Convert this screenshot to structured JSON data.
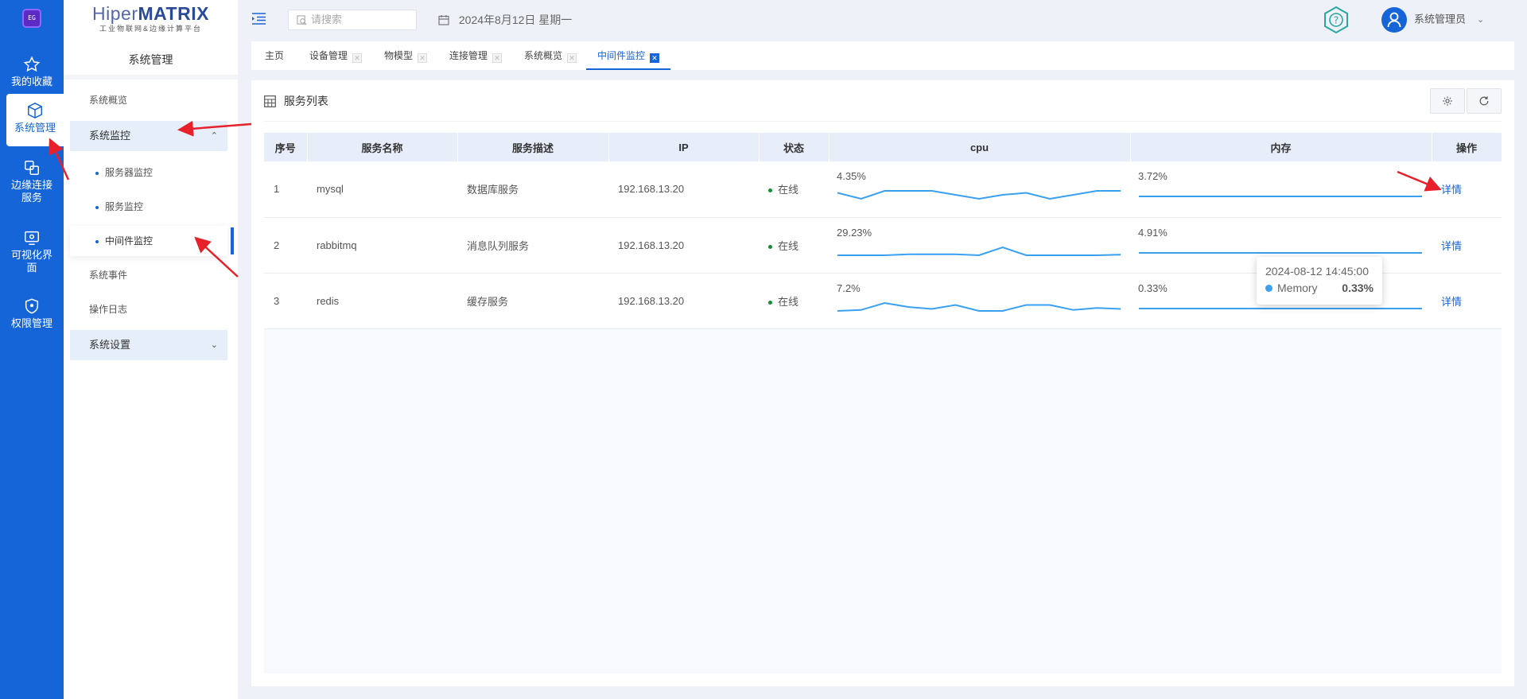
{
  "rail": {
    "logo_text": "EG",
    "items": [
      {
        "label": "我的收藏",
        "icon": "star-icon"
      },
      {
        "label": "系统管理",
        "icon": "box-icon"
      },
      {
        "label": "边缘连接服务",
        "label_lines": [
          "边缘连接",
          "服务"
        ],
        "icon": "link-icon"
      },
      {
        "label": "可视化界面",
        "label_lines": [
          "可视化界",
          "面"
        ],
        "icon": "monitor-icon"
      },
      {
        "label": "权限管理",
        "icon": "shield-icon"
      }
    ]
  },
  "brand": {
    "name_light": "Hiper",
    "name_bold": "MATRIX",
    "subtitle": "工业物联网&边缘计算平台"
  },
  "sidebar": {
    "title": "系统管理",
    "items": [
      {
        "label": "系统概览"
      },
      {
        "label": "系统监控",
        "expanded": true
      },
      {
        "label": "服务器监控"
      },
      {
        "label": "服务监控"
      },
      {
        "label": "中间件监控",
        "active": true
      },
      {
        "label": "系统事件"
      },
      {
        "label": "操作日志"
      },
      {
        "label": "系统设置",
        "expanded": false
      }
    ]
  },
  "header": {
    "search_placeholder": "请搜索",
    "date": "2024年8月12日 星期一",
    "user_name": "系统管理员"
  },
  "tabs": [
    {
      "label": "主页",
      "closable": false
    },
    {
      "label": "设备管理",
      "closable": true
    },
    {
      "label": "物模型",
      "closable": true
    },
    {
      "label": "连接管理",
      "closable": true
    },
    {
      "label": "系统概览",
      "closable": true
    },
    {
      "label": "中间件监控",
      "closable": true,
      "active": true
    }
  ],
  "card": {
    "title": "服务列表",
    "columns": [
      "序号",
      "服务名称",
      "服务描述",
      "IP",
      "状态",
      "cpu",
      "内存",
      "操作"
    ],
    "rows": [
      {
        "no": "1",
        "name": "mysql",
        "desc": "数据库服务",
        "ip": "192.168.13.20",
        "status": "在线",
        "cpu": "4.35%",
        "mem": "3.72%",
        "op": "详情",
        "cpu_series": [
          4.35,
          4.2,
          4.4,
          4.4,
          4.4,
          4.3,
          4.2,
          4.3,
          4.35,
          4.2,
          4.3,
          4.4,
          4.4
        ],
        "mem_series": [
          3.72,
          3.72,
          3.72,
          3.72,
          3.72,
          3.72,
          3.72,
          3.72,
          3.72,
          3.72,
          3.72,
          3.72,
          3.72
        ]
      },
      {
        "no": "2",
        "name": "rabbitmq",
        "desc": "消息队列服务",
        "ip": "192.168.13.20",
        "status": "在线",
        "cpu": "29.23%",
        "mem": "4.91%",
        "op": "详情",
        "cpu_series": [
          29.2,
          29.2,
          29.2,
          29.25,
          29.25,
          29.25,
          29.2,
          29.6,
          29.2,
          29.2,
          29.2,
          29.2,
          29.23
        ],
        "mem_series": [
          4.91,
          4.91,
          4.91,
          4.91,
          4.91,
          4.91,
          4.91,
          4.91,
          4.91,
          4.91,
          4.91,
          4.91,
          4.91
        ]
      },
      {
        "no": "3",
        "name": "redis",
        "desc": "缓存服务",
        "ip": "192.168.13.20",
        "status": "在线",
        "cpu": "7.2%",
        "mem": "0.33%",
        "op": "详情",
        "cpu_series": [
          7.0,
          7.1,
          7.8,
          7.4,
          7.2,
          7.6,
          7.0,
          7.0,
          7.6,
          7.6,
          7.1,
          7.3,
          7.2
        ],
        "mem_series": [
          0.33,
          0.33,
          0.33,
          0.33,
          0.33,
          0.33,
          0.33,
          0.33,
          0.33,
          0.33,
          0.33,
          0.33,
          0.33
        ]
      }
    ]
  },
  "tooltip": {
    "time": "2024-08-12 14:45:00",
    "series": "Memory",
    "value": "0.33%"
  },
  "colors": {
    "primary": "#1565d8",
    "spark": "#3aa0f0",
    "online": "#1a8a3a",
    "annotation": "#e8202a"
  }
}
